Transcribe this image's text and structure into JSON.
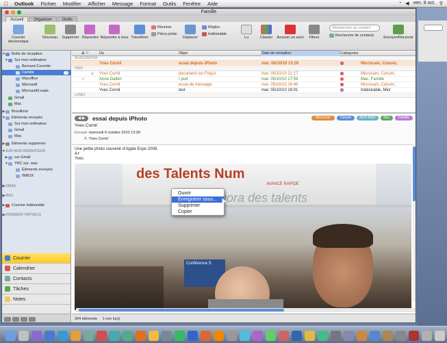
{
  "menubar": {
    "app": "Outlook",
    "items": [
      "Fichier",
      "Modifier",
      "Afficher",
      "Message",
      "Format",
      "Outils",
      "Fenêtre",
      "Aide"
    ],
    "clock": "ven. 8 oct."
  },
  "window": {
    "title": "Famille"
  },
  "tabs": [
    "Accueil",
    "Organiser",
    "Outils"
  ],
  "ribbon": {
    "big_buttons": [
      "Courrier électronique",
      "Nouveau",
      "Supprimer",
      "Répondre",
      "Répondre à tous",
      "Transférer",
      "Déplacer",
      "Lu",
      "Classer",
      "Assurer un suivi",
      "Filtres",
      "Envoyer/Recevoir"
    ],
    "small": {
      "reunion": "Réunion",
      "piece_jointe": "Pièce jointe",
      "regles": "Règles",
      "indesirable": "Indésirable",
      "search_contact": "Rechercher un contact",
      "recherche_contacts": "Recherche de contacts"
    }
  },
  "sidebar": {
    "items": [
      {
        "label": "Boîte de réception",
        "sel": false
      },
      {
        "label": "Sur mon ordinateur",
        "sel": false
      },
      {
        "label": "Bernard-Corentin",
        "sel": false
      },
      {
        "label": "Famille",
        "sel": true,
        "badge": "1"
      },
      {
        "label": "Macoffice",
        "sel": false
      },
      {
        "label": "Microsoft",
        "sel": false
      },
      {
        "label": "Microsoft/Leads",
        "sel": false
      },
      {
        "label": "Gmail",
        "sel": false
      },
      {
        "label": "Mac",
        "sel": false
      },
      {
        "label": "Brouillons",
        "sel": false
      },
      {
        "label": "Éléments envoyés",
        "sel": false
      },
      {
        "label": "Sur mon ordinateur",
        "sel": false
      },
      {
        "label": "Gmail",
        "sel": false
      },
      {
        "label": "Mac",
        "sel": false
      },
      {
        "label": "Éléments supprimés",
        "sel": false
      },
      {
        "label": "SUR MON ORDINATEUR",
        "sel": false
      },
      {
        "label": "sur Gmail",
        "sel": false
      },
      {
        "label": "YRC sur .mac",
        "sel": false
      },
      {
        "label": "Éléments envoyés",
        "sel": false
      },
      {
        "label": "INBOX",
        "sel": false
      },
      {
        "label": "GMAIL",
        "sel": false
      },
      {
        "label": "MAC",
        "sel": false
      },
      {
        "label": "Courrier indésirable",
        "sel": false
      },
      {
        "label": "DOSSIERS VIRTUELS",
        "sel": false
      }
    ],
    "nav": [
      "Courrier",
      "Calendrier",
      "Contacts",
      "Tâches",
      "Notes"
    ]
  },
  "list": {
    "headers": {
      "de": "De",
      "objet": "Objet",
      "date": "Date de réception",
      "categories": "Catégories"
    },
    "group_today": "AUJOURD'HUI",
    "group_yesterday": "HIER",
    "group_monday": "LUNDI",
    "rows": [
      {
        "from": "Yves Cornil",
        "subject": "essai depuis iPhoto",
        "date": "mer. 06/10/10 13:30",
        "cats": "Microcam, Conum,"
      },
      {
        "from": "Yves Cornil",
        "subject": "document sur Frejus",
        "date": "mar. 05/10/10 21:17",
        "cats": "Microcam, Conum,"
      },
      {
        "from": "Anne Dalbin",
        "subject": "I pod",
        "date": "mar. 05/10/10 17:59",
        "cats": "Mac, Famille"
      },
      {
        "from": "Yves Cornil",
        "subject": "essai de message.",
        "date": "mar. 05/10/10 16:49",
        "cats": "Microcam, Conum,"
      },
      {
        "from": "Yves Cornil",
        "subject": "test",
        "date": "mar. 05/10/10 16:01",
        "cats": "Indésirable, Micr"
      }
    ]
  },
  "preview": {
    "subject": "essai depuis iPhoto",
    "from": "Yves Cornil",
    "sent_label": "Envoyé :",
    "sent": "mercredi 6 octobre 2010 13:30",
    "to_label": "À :",
    "to": "Yves Cornil",
    "categories": [
      "Microcam",
      "Conum",
      "MVP-MSP",
      "Mac",
      "Famille"
    ],
    "body": [
      "Une petite photo souvenir d'Apple Expo 2008.",
      "A+",
      "Yves"
    ],
    "photo_text": [
      "des Talents Num",
      "AVANCE RAPIDE",
      "Agora des talents",
      "Conférence S"
    ]
  },
  "context_menu": [
    "Ouvrir",
    "Enregistrer sous...",
    "Supprimer",
    "Copier"
  ],
  "status": {
    "count": "344 éléments",
    "unread": "1 non lu(s)"
  }
}
